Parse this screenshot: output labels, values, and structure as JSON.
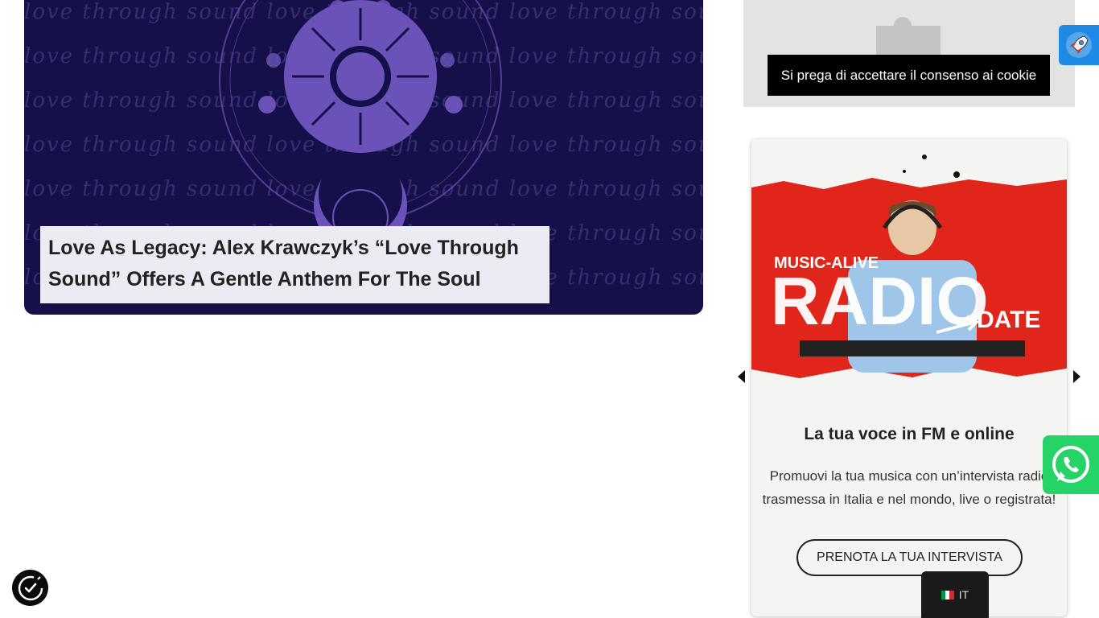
{
  "post": {
    "title": "Love As Legacy: Alex Krawczyk’s “Love Through Sound” Offers A Gentle Anthem For The Soul",
    "bg_text": "love through sound love through sound love through sound"
  },
  "cookie": {
    "button_label": "Si prega di accettare il consenso ai cookie"
  },
  "promo": {
    "image_brand": "MUSIC-ALIVE",
    "image_word": "RADIO",
    "image_sub": "DATE",
    "heading": "La tua voce in FM e online",
    "text": "Promuovi la tua musica con un’intervista radio trasmessa in Italia e nel mondo, live o registrata!",
    "cta_label": "PRENOTA LA TUA INTERVISTA"
  },
  "language": {
    "code": "IT",
    "flag_colors": [
      "#009246",
      "#ffffff",
      "#ce2b37"
    ]
  },
  "colors": {
    "post_bg": "#15104a",
    "art_purple": "#6a52b8",
    "promo_red": "#e0261b",
    "whatsapp": "#25d366",
    "rocket_badge": "#1e8ae6"
  },
  "icons": [
    "puzzle-icon",
    "rocket-icon",
    "whatsapp-icon",
    "accessibility-icon",
    "chevron-left-icon",
    "chevron-right-icon"
  ]
}
